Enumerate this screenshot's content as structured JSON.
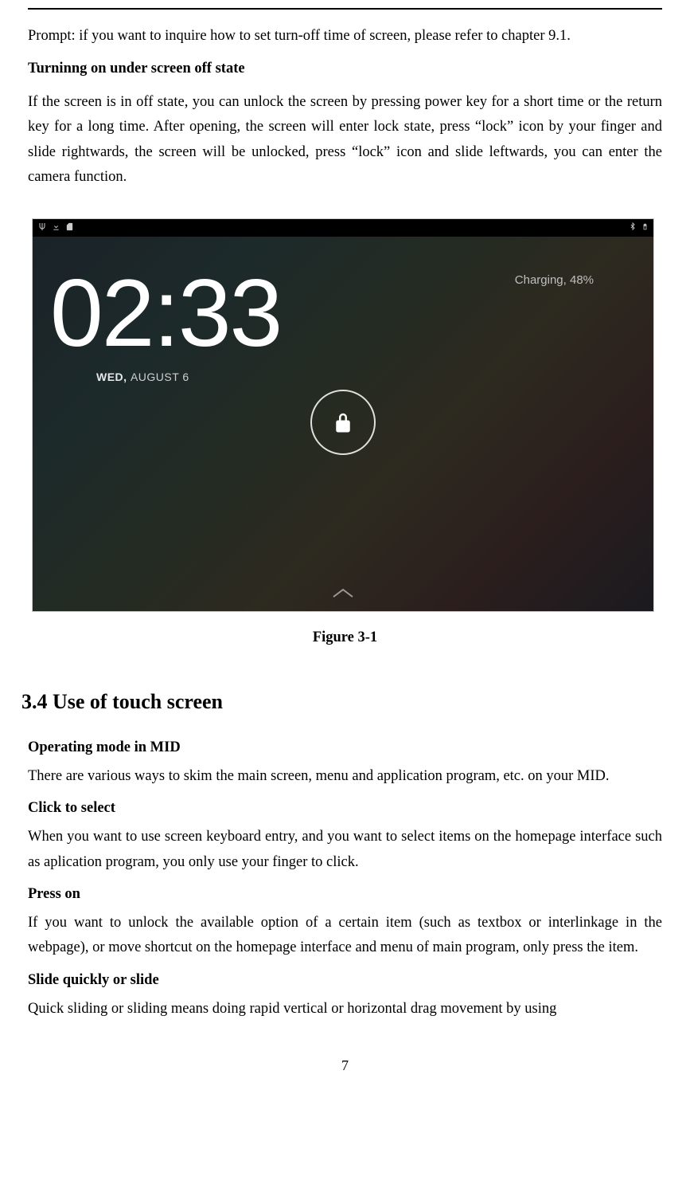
{
  "prompt_line": "Prompt: if you want to inquire how to set turn-off time of screen, please refer to chapter 9.1.",
  "sub1_title": "Turninng on under screen off state",
  "sub1_body": "If the screen is in off state, you can unlock the screen by pressing power key for a short time or the return key for a long time. After opening, the screen will enter lock state, press “lock” icon by your finger and slide rightwards, the screen will be unlocked, press “lock” icon and slide leftwards, you can enter the camera function.",
  "screenshot": {
    "time": "02:33",
    "date_prefix": "WED, ",
    "date_main": "AUGUST 6",
    "charging": "Charging, 48%"
  },
  "figure_caption": "Figure 3-1",
  "section_heading": "3.4  Use of touch screen",
  "sub2_title": "Operating mode in MID",
  "sub2_body": "There are various ways to skim the main screen, menu and application program, etc. on your MID.",
  "sub3_title": "Click to select",
  "sub3_body": "When you want to use screen keyboard entry, and you want to select items on the homepage interface such as aplication program, you only use your finger to click.",
  "sub4_title": "Press on",
  "sub4_body": "If you want to unlock the available option of a certain item (such as textbox or interlinkage in the webpage), or move shortcut on the homepage interface and menu of main program, only press the item.",
  "sub5_title": "Slide quickly or slide",
  "sub5_body": "Quick sliding or sliding means doing rapid vertical or horizontal drag movement by using",
  "page_number": "7"
}
